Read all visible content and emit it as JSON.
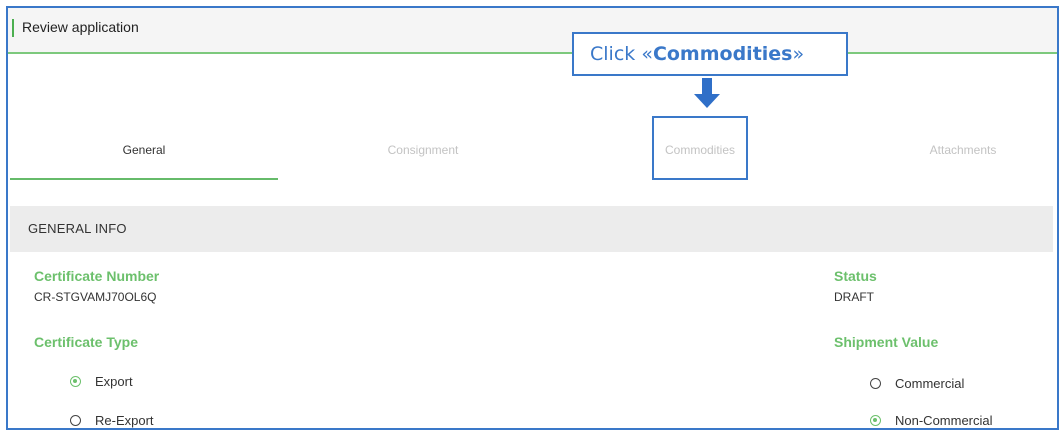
{
  "header": {
    "title": "Review application"
  },
  "callout": {
    "prefix": "Click «",
    "target": "Commodities",
    "suffix": "»"
  },
  "tabs": [
    {
      "label": "General",
      "active": true
    },
    {
      "label": "Consignment",
      "active": false
    },
    {
      "label": "Commodities",
      "active": false
    },
    {
      "label": "Attachments",
      "active": false
    }
  ],
  "section": {
    "title": "GENERAL INFO"
  },
  "fields": {
    "certificate_number": {
      "label": "Certificate Number",
      "value": "CR-STGVAMJ70OL6Q"
    },
    "status": {
      "label": "Status",
      "value": "DRAFT"
    },
    "certificate_type": {
      "label": "Certificate Type",
      "options": [
        {
          "label": "Export",
          "selected": true
        },
        {
          "label": "Re-Export",
          "selected": false
        }
      ]
    },
    "shipment_value": {
      "label": "Shipment Value",
      "options": [
        {
          "label": "Commercial",
          "selected": false
        },
        {
          "label": "Non-Commercial",
          "selected": true
        }
      ]
    }
  },
  "colors": {
    "accent_green": "#6cc06c",
    "callout_blue": "#3a78c9"
  }
}
